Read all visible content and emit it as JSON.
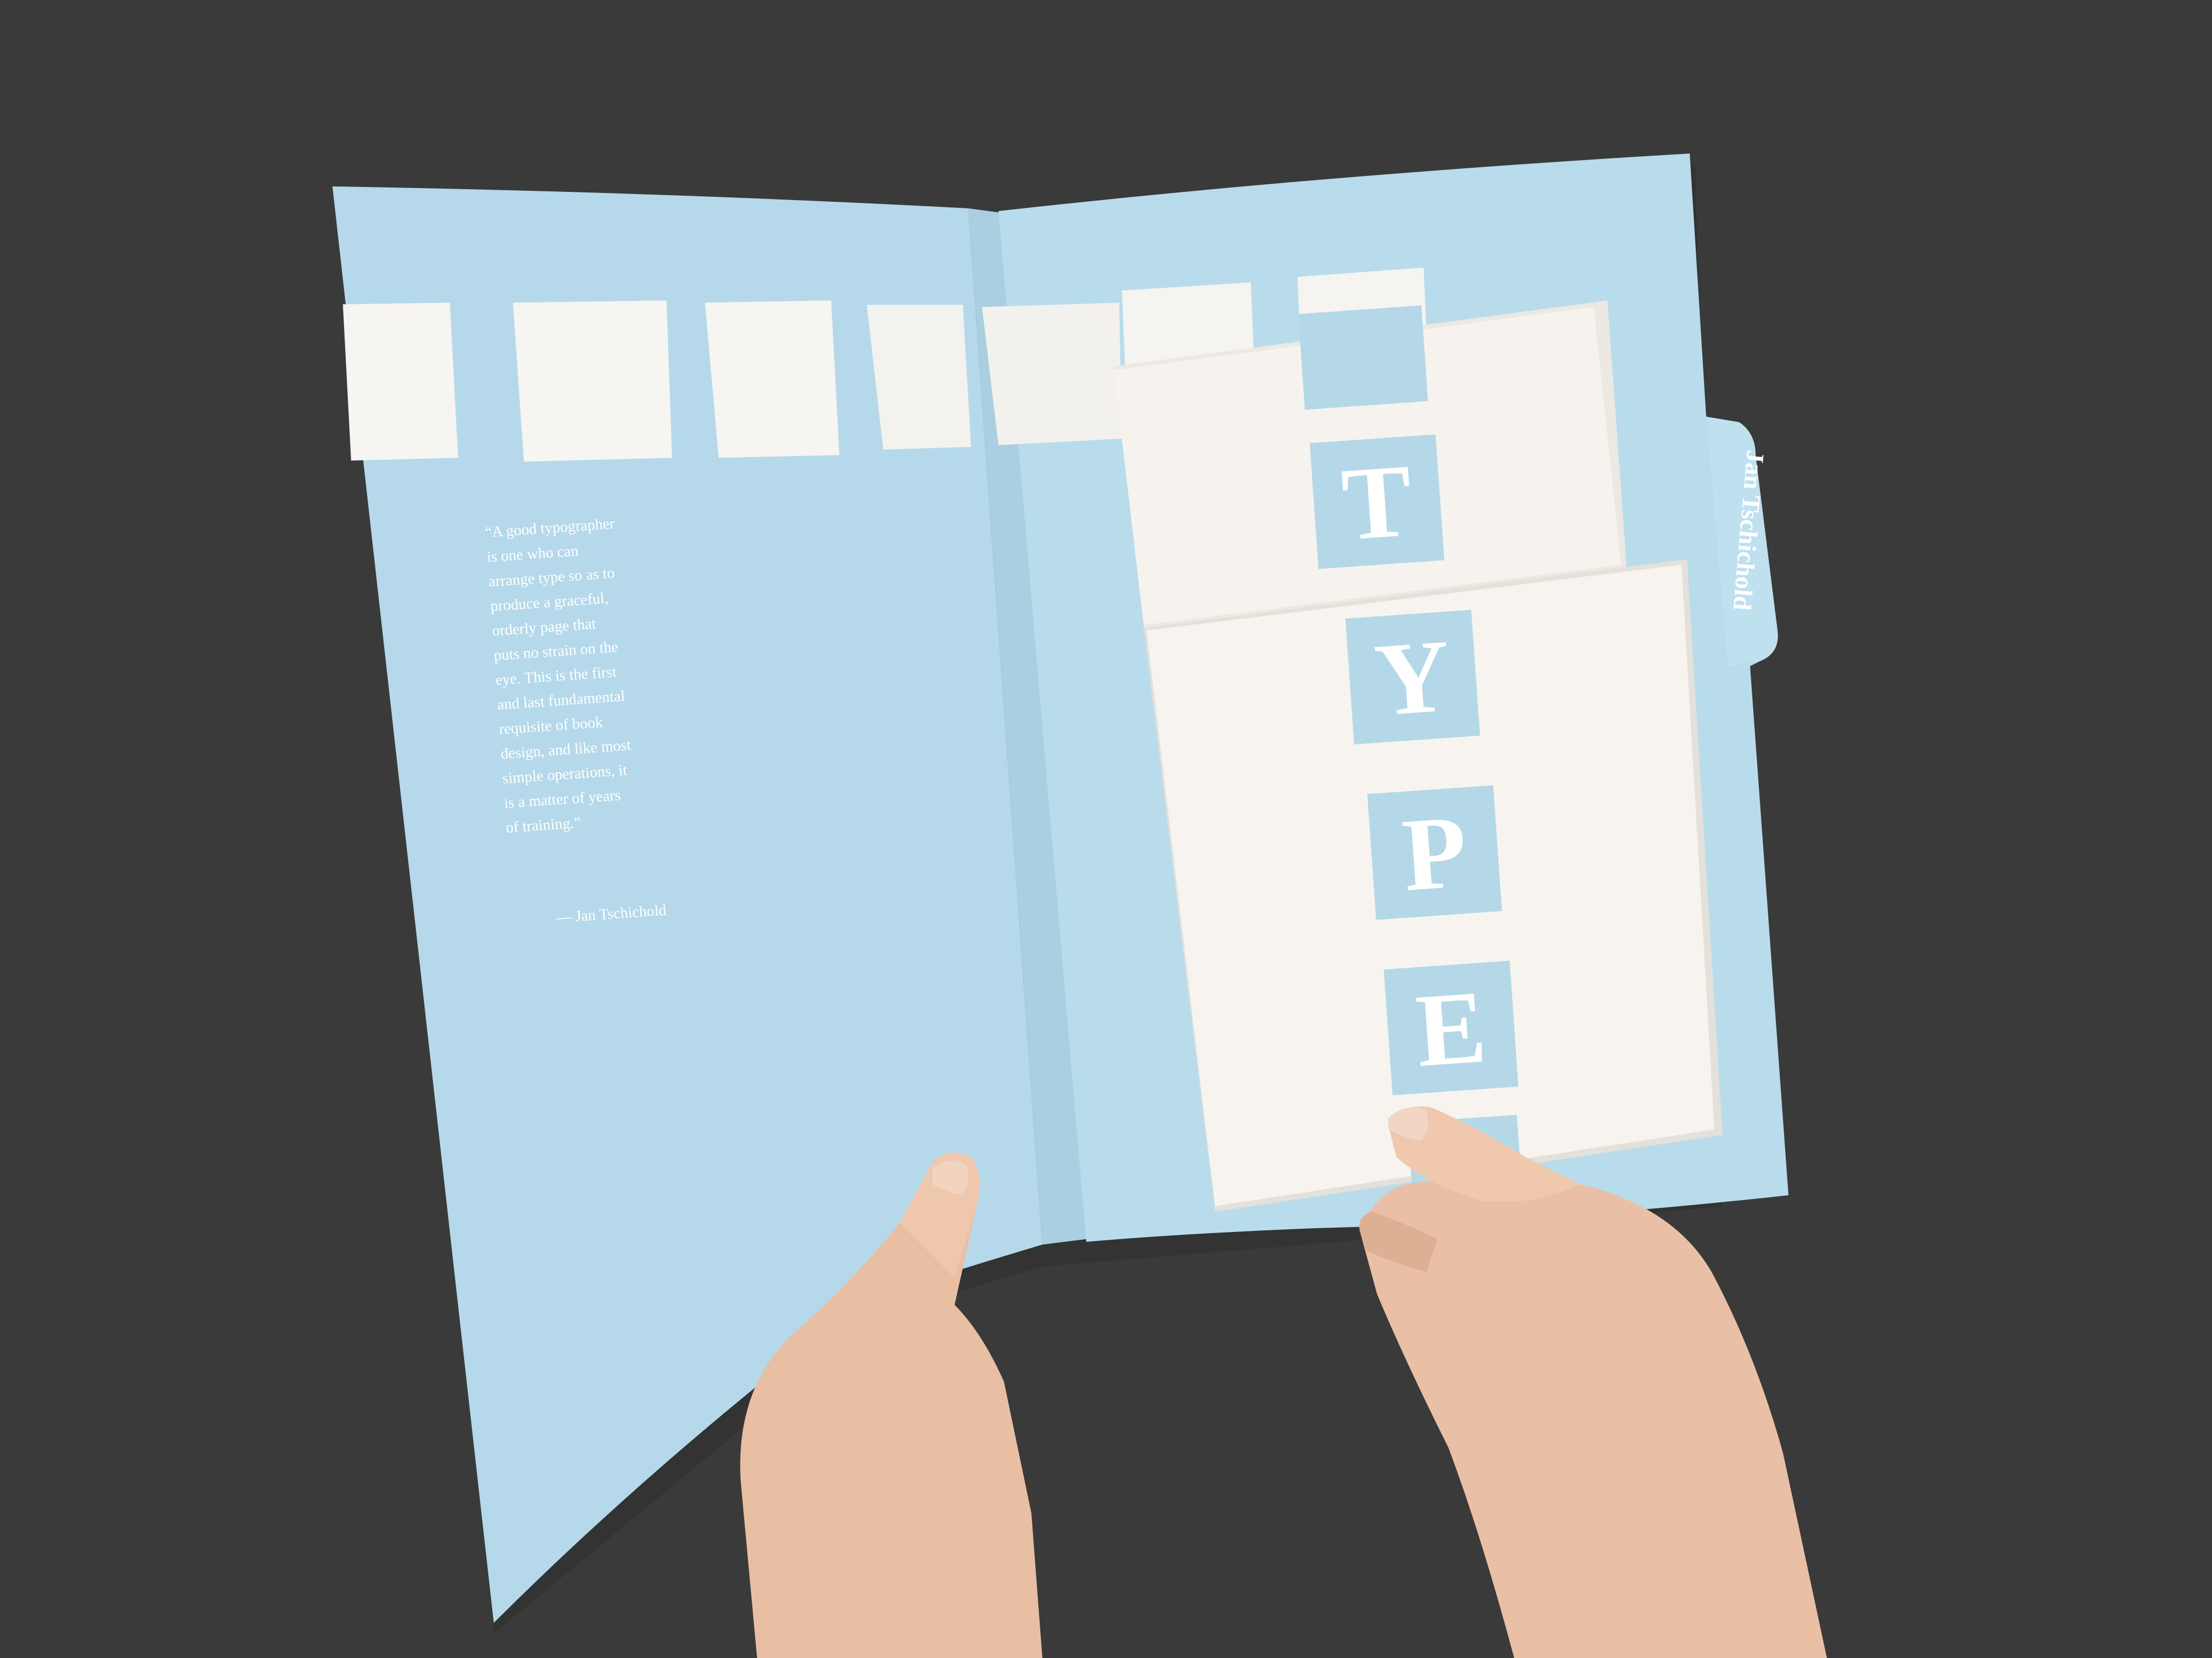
{
  "colors": {
    "background": "#3a3a3a",
    "folder_blue": "#b4d8e8",
    "folder_blue_shadow": "#a2c6d7",
    "paper_white": "#f6f3ee",
    "square_white": "#f8f6f2",
    "skin": "#e9c0a6"
  },
  "quote": {
    "lines": [
      "“A good typographer",
      "is one who can",
      "arrange type so as to",
      "produce a graceful,",
      "orderly page that",
      "puts no strain on the",
      "eye. This is the first",
      "and last fundamental",
      "requisite of book",
      "design, and like most",
      "simple operations, it",
      "is a matter of years",
      "of training.”"
    ],
    "attribution": "— Jan Tschichold"
  },
  "tab_label": "Jan Tschichold",
  "type_letters": [
    "T",
    "Y",
    "P",
    "E"
  ]
}
